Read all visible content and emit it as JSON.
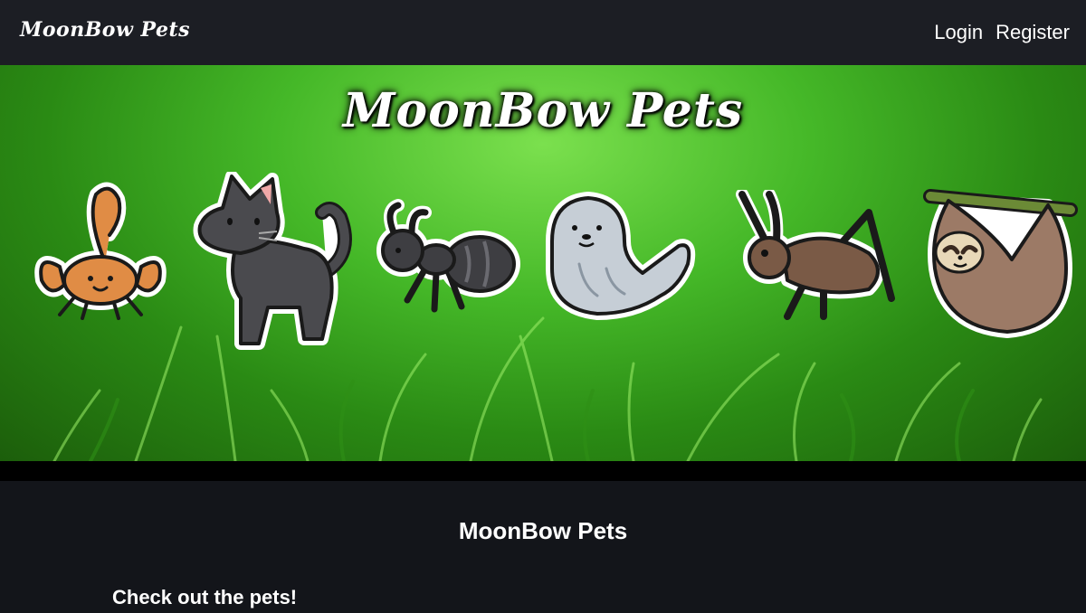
{
  "navbar": {
    "brand": "MoonBow Pets",
    "links": [
      {
        "label": "Login"
      },
      {
        "label": "Register"
      }
    ]
  },
  "hero": {
    "title": "MoonBow Pets",
    "pets": [
      {
        "icon": "scorpion-icon",
        "color": "#e08c45"
      },
      {
        "icon": "cat-icon",
        "color": "#4a4a4e"
      },
      {
        "icon": "ant-icon",
        "color": "#3e3e42"
      },
      {
        "icon": "seal-icon",
        "color": "#c6ced6"
      },
      {
        "icon": "cricket-icon",
        "color": "#7a5a46"
      },
      {
        "icon": "sloth-icon",
        "color": "#9c7a66"
      }
    ],
    "background_color": "#45b828"
  },
  "main": {
    "heading": "MoonBow Pets",
    "section_heading": "Check out the pets!"
  },
  "colors": {
    "navbar_bg": "#1c1e24",
    "page_bg": "#13151a",
    "text": "#ffffff"
  }
}
